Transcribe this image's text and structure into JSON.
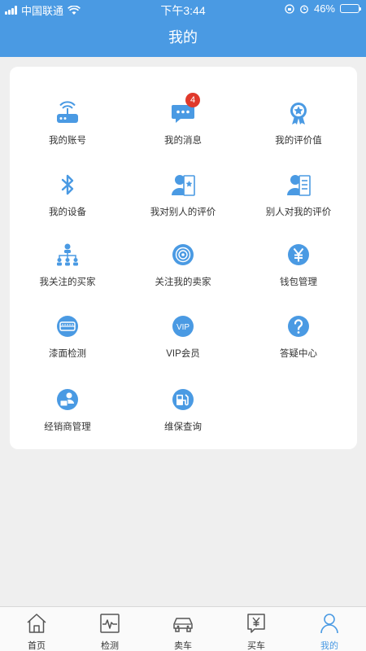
{
  "status_bar": {
    "carrier": "中国联通",
    "time": "下午3:44",
    "battery": "46%",
    "battery_level": 0.46
  },
  "header": {
    "title": "我的"
  },
  "menu": {
    "account": "我的账号",
    "messages": "我的消息",
    "messages_badge": "4",
    "rating_value": "我的评价值",
    "devices": "我的设备",
    "my_reviews_of_others": "我对别人的评价",
    "reviews_of_me": "别人对我的评价",
    "followed_buyers": "我关注的买家",
    "sellers_following_me": "关注我的卖家",
    "wallet": "钱包管理",
    "paint_check": "漆面检测",
    "vip": "VIP会员",
    "vip_icon_text": "VIP",
    "help": "答疑中心",
    "dealer_management": "经销商管理",
    "maintenance_query": "维保查询"
  },
  "tabbar": {
    "home": "首页",
    "inspection": "检测",
    "sell_car": "卖车",
    "buy_car": "买车",
    "mine": "我的",
    "active": "mine"
  },
  "colors": {
    "primary": "#4a9ae3",
    "badge": "#e0392b",
    "background": "#efefef"
  }
}
